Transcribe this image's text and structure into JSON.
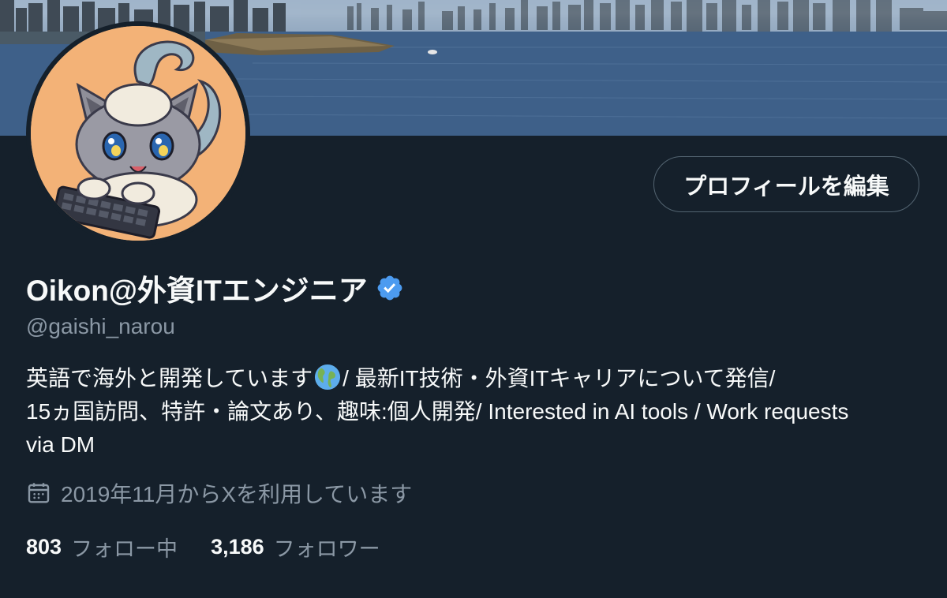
{
  "profile": {
    "display_name": "Oikon@外資ITエンジニア",
    "handle": "@gaishi_narou",
    "bio_line1_a": "英語で海外と開発しています",
    "bio_line1_b": "/ 最新IT技術・外資ITキャリアについて発信/",
    "bio_line2": "15ヵ国訪問、特許・論文あり、趣味:個人開発/ Interested in AI tools / Work requests",
    "bio_line3": "via DM",
    "joined": "2019年11月からXを利用しています",
    "verified_color": "#4c9bf0"
  },
  "actions": {
    "edit_profile_label": "プロフィールを編集"
  },
  "stats": {
    "following_count": "803",
    "following_label": "フォロー中",
    "followers_count": "3,186",
    "followers_label": "フォロワー"
  },
  "colors": {
    "background": "#15202b",
    "text_primary": "#f7f9f9",
    "text_secondary": "#8b98a5",
    "border": "#536471"
  },
  "icons": {
    "verified": "verified-badge-icon",
    "globe": "globe-emoji-icon",
    "calendar": "calendar-icon"
  }
}
